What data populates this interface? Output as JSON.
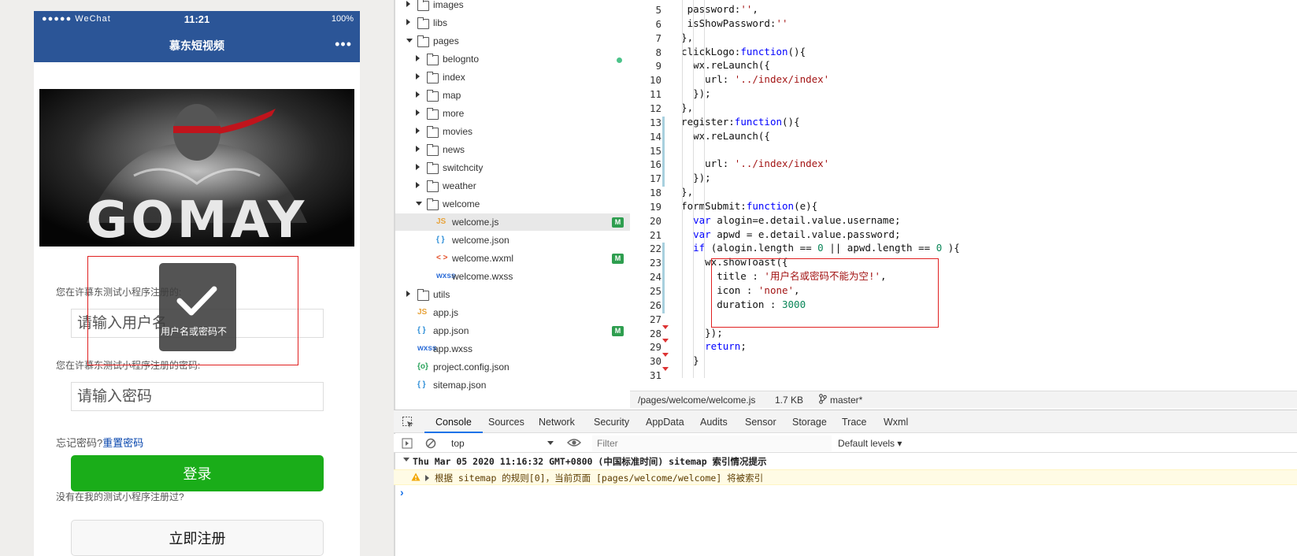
{
  "simulator": {
    "status": {
      "signal": "●●●●● WeChat",
      "wifi": "wifi-icon",
      "time": "11:21",
      "battery": "100%"
    },
    "navbar": {
      "title": "慕东短视频",
      "more": "•••"
    },
    "banner": {
      "text": "GOMAY"
    },
    "form": {
      "username_label": "您在许慕东测试小程序注册的:",
      "username_placeholder": "请输入用户名",
      "password_label": "您在许慕东测试小程序注册的密码:",
      "password_placeholder": "请输入密码",
      "forgot_text": "忘记密码?",
      "reset_link": "重置密码",
      "login_button": "登录",
      "not_registered": "没有在我的测试小程序注册过?",
      "register_button": "立即注册"
    },
    "toast": {
      "icon": "check-icon",
      "message": "用户名或密码不"
    }
  },
  "file_tree": [
    {
      "name": "images",
      "kind": "folder",
      "state": "collapsed",
      "depth": 0
    },
    {
      "name": "libs",
      "kind": "folder",
      "state": "collapsed",
      "depth": 0
    },
    {
      "name": "pages",
      "kind": "folder",
      "state": "expanded",
      "depth": 0
    },
    {
      "name": "belognto",
      "kind": "folder",
      "state": "collapsed",
      "depth": 1,
      "dot": true
    },
    {
      "name": "index",
      "kind": "folder",
      "state": "collapsed",
      "depth": 1
    },
    {
      "name": "map",
      "kind": "folder",
      "state": "collapsed",
      "depth": 1
    },
    {
      "name": "more",
      "kind": "folder",
      "state": "collapsed",
      "depth": 1
    },
    {
      "name": "movies",
      "kind": "folder",
      "state": "collapsed",
      "depth": 1
    },
    {
      "name": "news",
      "kind": "folder",
      "state": "collapsed",
      "depth": 1
    },
    {
      "name": "switchcity",
      "kind": "folder",
      "state": "collapsed",
      "depth": 1
    },
    {
      "name": "weather",
      "kind": "folder",
      "state": "collapsed",
      "depth": 1
    },
    {
      "name": "welcome",
      "kind": "folder",
      "state": "expanded",
      "depth": 1
    },
    {
      "name": "welcome.js",
      "kind": "js",
      "depth": 2,
      "badge": "M",
      "selected": true
    },
    {
      "name": "welcome.json",
      "kind": "json",
      "depth": 2
    },
    {
      "name": "welcome.wxml",
      "kind": "wxml",
      "depth": 2,
      "badge": "M"
    },
    {
      "name": "welcome.wxss",
      "kind": "wxss",
      "depth": 2
    },
    {
      "name": "utils",
      "kind": "folder",
      "state": "collapsed",
      "depth": 0
    },
    {
      "name": "app.js",
      "kind": "js",
      "depth": 0
    },
    {
      "name": "app.json",
      "kind": "json",
      "depth": 0,
      "badge": "M"
    },
    {
      "name": "app.wxss",
      "kind": "wxss",
      "depth": 0
    },
    {
      "name": "project.config.json",
      "kind": "cfg",
      "depth": 0
    },
    {
      "name": "sitemap.json",
      "kind": "json",
      "depth": 0
    }
  ],
  "icon_glyphs": {
    "js": "JS",
    "json": "{ }",
    "wxml": "< >",
    "wxss": "wxss",
    "cfg": "{o}"
  },
  "editor": {
    "lines": [
      {
        "n": "5",
        "code": [
          [
            "   password:",
            ""
          ],
          [
            "''",
            "st"
          ],
          [
            ",",
            ""
          ]
        ]
      },
      {
        "n": "6",
        "code": [
          [
            "   isShowPassword:",
            ""
          ],
          [
            "''",
            "st"
          ]
        ]
      },
      {
        "n": "7",
        "code": [
          [
            "  },",
            ""
          ]
        ]
      },
      {
        "n": "8",
        "code": [
          [
            "  clickLogo:",
            ""
          ],
          [
            "function",
            "kw"
          ],
          [
            "(){",
            ""
          ]
        ]
      },
      {
        "n": "9",
        "code": [
          [
            "    wx.reLaunch({",
            ""
          ]
        ]
      },
      {
        "n": "10",
        "code": [
          [
            "      url: ",
            ""
          ],
          [
            "'../index/index'",
            "st"
          ]
        ]
      },
      {
        "n": "11",
        "code": [
          [
            "    });",
            ""
          ]
        ]
      },
      {
        "n": "12",
        "code": [
          [
            "  },",
            ""
          ]
        ]
      },
      {
        "n": "13",
        "code": [
          [
            "  register:",
            ""
          ],
          [
            "function",
            "kw"
          ],
          [
            "(){",
            ""
          ]
        ]
      },
      {
        "n": "14",
        "code": [
          [
            "    wx.reLaunch({",
            ""
          ]
        ]
      },
      {
        "n": "15",
        "code": [
          [
            "",
            ""
          ]
        ]
      },
      {
        "n": "16",
        "code": [
          [
            "      url: ",
            ""
          ],
          [
            "'../index/index'",
            "st"
          ]
        ]
      },
      {
        "n": "17",
        "code": [
          [
            "    });",
            ""
          ]
        ]
      },
      {
        "n": "18",
        "code": [
          [
            "  },",
            ""
          ]
        ]
      },
      {
        "n": "19",
        "code": [
          [
            "  formSubmit:",
            ""
          ],
          [
            "function",
            "kw"
          ],
          [
            "(e){",
            ""
          ]
        ]
      },
      {
        "n": "20",
        "code": [
          [
            "    ",
            ""
          ],
          [
            "var",
            "kw"
          ],
          [
            " alogin=e.detail.value.username;",
            ""
          ]
        ]
      },
      {
        "n": "21",
        "code": [
          [
            "    ",
            ""
          ],
          [
            "var",
            "kw"
          ],
          [
            " apwd = e.detail.value.password;",
            ""
          ]
        ]
      },
      {
        "n": "22",
        "code": [
          [
            "    ",
            ""
          ],
          [
            "if",
            "kw"
          ],
          [
            " (alogin.length == ",
            ""
          ],
          [
            "0",
            "nm"
          ],
          [
            " || apwd.length == ",
            ""
          ],
          [
            "0",
            "nm"
          ],
          [
            " ){",
            ""
          ]
        ]
      },
      {
        "n": "23",
        "code": [
          [
            "      wx.showToast({",
            ""
          ]
        ]
      },
      {
        "n": "24",
        "code": [
          [
            "        title : ",
            ""
          ],
          [
            "'用户名或密码不能为空!'",
            "st"
          ],
          [
            ",",
            ""
          ]
        ]
      },
      {
        "n": "25",
        "code": [
          [
            "        icon : ",
            ""
          ],
          [
            "'none'",
            "st"
          ],
          [
            ",",
            ""
          ]
        ]
      },
      {
        "n": "26",
        "code": [
          [
            "        duration : ",
            ""
          ],
          [
            "3000",
            "nm"
          ]
        ]
      },
      {
        "n": "27",
        "code": [
          [
            "",
            ""
          ]
        ]
      },
      {
        "n": "28",
        "code": [
          [
            "      });",
            ""
          ]
        ]
      },
      {
        "n": "29",
        "code": [
          [
            "      ",
            ""
          ],
          [
            "return",
            "kw"
          ],
          [
            ";",
            ""
          ]
        ]
      },
      {
        "n": "30",
        "code": [
          [
            "    }",
            ""
          ]
        ]
      },
      {
        "n": "31",
        "code": [
          [
            "",
            ""
          ]
        ]
      }
    ]
  },
  "filebar": {
    "path": "/pages/welcome/welcome.js",
    "size": "1.7 KB",
    "branch_icon": "git-branch-icon",
    "branch": "master*"
  },
  "devtools": {
    "tabs": [
      "Console",
      "Sources",
      "Network",
      "Security",
      "AppData",
      "Audits",
      "Sensor",
      "Storage",
      "Trace",
      "Wxml"
    ],
    "active_tab": "Console",
    "context": "top",
    "filter_placeholder": "Filter",
    "levels": "Default levels ▾",
    "log_group": "Thu Mar 05 2020 11:16:32 GMT+0800 (中国标准时间) sitemap 索引情况提示",
    "log_warning": "根据 sitemap 的规则[0]，当前页面 [pages/welcome/welcome] 将被索引"
  },
  "colors": {
    "navbar": "#2b5597",
    "login_green": "#1aad19",
    "accent": "#1a73e8",
    "highlight_red": "#e02020"
  }
}
